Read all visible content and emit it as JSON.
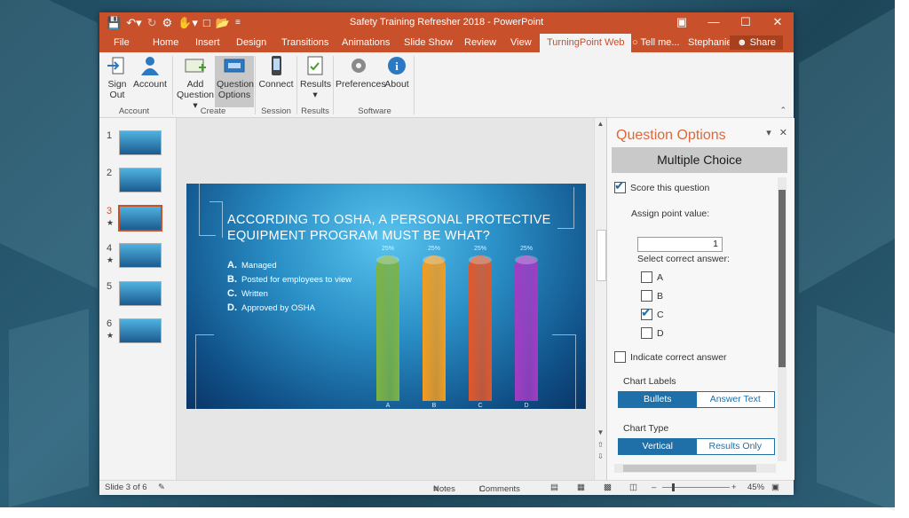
{
  "window": {
    "title": "Safety Training Refresher 2018 - PowerPoint",
    "controls": [
      "restore-ribbon",
      "minimize",
      "maximize",
      "close"
    ]
  },
  "qat_icons": [
    "save-icon",
    "undo-icon",
    "redo-icon",
    "turningpoint-icon",
    "pointer-icon",
    "new-icon",
    "open-icon",
    "customize-icon"
  ],
  "tabs": [
    {
      "label": "File"
    },
    {
      "label": "Home"
    },
    {
      "label": "Insert"
    },
    {
      "label": "Design"
    },
    {
      "label": "Transitions"
    },
    {
      "label": "Animations"
    },
    {
      "label": "Slide Show"
    },
    {
      "label": "Review"
    },
    {
      "label": "View"
    },
    {
      "label": "TurningPoint Web",
      "active": true
    }
  ],
  "tell_me": "Tell me...",
  "user": "Stephanie...",
  "share": "Share",
  "ribbon": {
    "buttons": [
      {
        "label": "Sign\nOut",
        "icon": "sign-out-icon"
      },
      {
        "label": "Account",
        "icon": "account-icon"
      },
      {
        "label": "Add\nQuestion ▾",
        "icon": "add-question-icon"
      },
      {
        "label": "Question\nOptions",
        "icon": "question-options-icon",
        "selected": true
      },
      {
        "label": "Connect",
        "icon": "phone-icon"
      },
      {
        "label": "Results\n▾",
        "icon": "results-icon"
      },
      {
        "label": "Preferences",
        "icon": "gear-icon"
      },
      {
        "label": "About",
        "icon": "info-icon"
      }
    ],
    "groups": [
      "Account",
      "Create",
      "Session",
      "Results",
      "Software"
    ]
  },
  "thumbnails": [
    {
      "num": "1",
      "star": ""
    },
    {
      "num": "2",
      "star": ""
    },
    {
      "num": "3",
      "star": "★",
      "selected": true
    },
    {
      "num": "4",
      "star": "★"
    },
    {
      "num": "5",
      "star": ""
    },
    {
      "num": "6",
      "star": "★"
    }
  ],
  "slide": {
    "question": "ACCORDING TO OSHA, A PERSONAL PROTECTIVE EQUIPMENT PROGRAM MUST BE WHAT?",
    "options": [
      {
        "letter": "A.",
        "text": "Managed"
      },
      {
        "letter": "B.",
        "text": "Posted for employees to view"
      },
      {
        "letter": "C.",
        "text": "Written"
      },
      {
        "letter": "D.",
        "text": "Approved by OSHA"
      }
    ]
  },
  "chart_data": {
    "type": "bar",
    "categories": [
      "A",
      "B",
      "C",
      "D"
    ],
    "values": [
      25,
      25,
      25,
      25
    ],
    "value_labels": [
      "25%",
      "25%",
      "25%",
      "25%"
    ],
    "colors": [
      "#7cb342",
      "#f39c1f",
      "#e0582b",
      "#a23cc4"
    ],
    "ylim": [
      0,
      25
    ]
  },
  "pane": {
    "title": "Question Options",
    "type_header": "Multiple Choice",
    "score_label": "Score this question",
    "score_checked": true,
    "point_label": "Assign point value:",
    "point_value": "1",
    "correct_label": "Select correct answer:",
    "answers": [
      {
        "label": "A",
        "checked": false
      },
      {
        "label": "B",
        "checked": false
      },
      {
        "label": "C",
        "checked": true
      },
      {
        "label": "D",
        "checked": false
      }
    ],
    "indicate_label": "Indicate correct answer",
    "indicate_checked": false,
    "chart_labels_title": "Chart Labels",
    "chart_labels_options": [
      "Bullets",
      "Answer Text"
    ],
    "chart_labels_selected": "Bullets",
    "chart_type_title": "Chart Type",
    "chart_type_options": [
      "Vertical",
      "Results Only"
    ],
    "chart_type_selected": "Vertical"
  },
  "status": {
    "slide_info": "Slide 3 of 6",
    "notes": "Notes",
    "comments": "Comments",
    "zoom": "45%"
  },
  "accent": "#c8502a",
  "pane_accent": "#1f6fa8"
}
